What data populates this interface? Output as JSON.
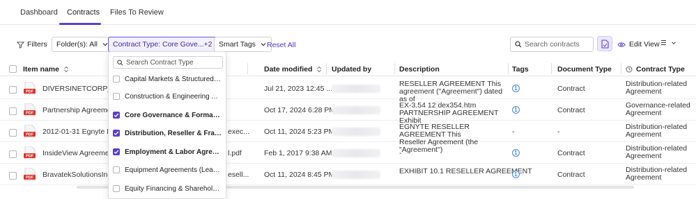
{
  "tabs": [
    {
      "label": "Dashboard"
    },
    {
      "label": "Contracts"
    },
    {
      "label": "Files To Review"
    }
  ],
  "filters": {
    "filters_label": "Filters",
    "folder_label": "Folder(s): All",
    "contract_type_label": "Contract Type: Core Gove...+2",
    "smart_tags_label": "Smart Tags",
    "reset_label": "Reset All",
    "search_placeholder": "Search contracts",
    "edit_view_label": "Edit View"
  },
  "table": {
    "headers": {
      "item_name": "Item name",
      "date_modified": "Date modified",
      "updated_by": "Updated by",
      "description": "Description",
      "tags": "Tags",
      "document_type": "Document Type",
      "contract_type": "Contract Type"
    },
    "rows": [
      {
        "name": "DIVERSINETCORP_03_0",
        "date": "Jul 21, 2023 12:45 ...",
        "desc1": "RESELLER AGREEMENT This",
        "desc2": "agreement (\"Agreement\") dated as of",
        "tags": "1",
        "doc_type": "Contract",
        "ctype1": "Distribution-related",
        "ctype2": "Agreement",
        "name_suffix": ""
      },
      {
        "name": "Partnership Agreement.",
        "date": "Oct 17, 2024 6:28 PM",
        "desc1": "EX-3.54 12 dex354.htm",
        "desc2": "PARTNERSHIP AGREEMENT Exhibit",
        "tags": "1",
        "doc_type": "Contract",
        "ctype1": "Governance-related",
        "ctype2": "Agreement",
        "name_suffix": ""
      },
      {
        "name": "2012-01-31 Egnyte Rese",
        "date": "Oct 11, 2024 5:23 PM",
        "desc1": "EGNYTE RESELLER AGREEMENT This",
        "desc2": "Reseller Agreement (the \"Agreement\")",
        "tags": "-",
        "doc_type": "-",
        "ctype1": "Distribution-related",
        "ctype2": "Agreement",
        "name_suffix": "exec..."
      },
      {
        "name": "InsideView Agreement -",
        "date": "Feb 1, 2017 9:38 AM",
        "desc1": "-",
        "desc2": "",
        "tags": "1",
        "doc_type": "Contract",
        "ctype1": "Distribution-related",
        "ctype2": "Agreement",
        "name_suffix": "l.pdf"
      },
      {
        "name": "BravatekSolutionsInc_20",
        "date": "Oct 11, 2024 8:45 PM",
        "desc1": "EXHIBIT 10.1   RESELLER AGREEMENT",
        "desc2": "",
        "tags": "1",
        "doc_type": "Contract",
        "ctype1": "Distribution-related",
        "ctype2": "Agreement",
        "name_suffix": "esell..."
      }
    ],
    "pdf_badge": "PDF"
  },
  "dropdown": {
    "search_placeholder": "Search Contract Type",
    "options": [
      {
        "label": "Capital Markets & Structured Fin...",
        "checked": false
      },
      {
        "label": "Construction & Engineering Agre...",
        "checked": false
      },
      {
        "label": "Core Governance & Formation A...",
        "checked": true
      },
      {
        "label": "Distribution, Reseller & Franchis...",
        "checked": true
      },
      {
        "label": "Employment & Labor Agreements",
        "checked": true
      },
      {
        "label": "Equipment Agreements (Lease & ...",
        "checked": false
      },
      {
        "label": "Equity Financing & Shareholder A...",
        "checked": false
      }
    ]
  },
  "colors": {
    "accent": "#5a3fd0",
    "tag_blue": "#2d6fc0",
    "pdf_red": "#d9342b"
  }
}
